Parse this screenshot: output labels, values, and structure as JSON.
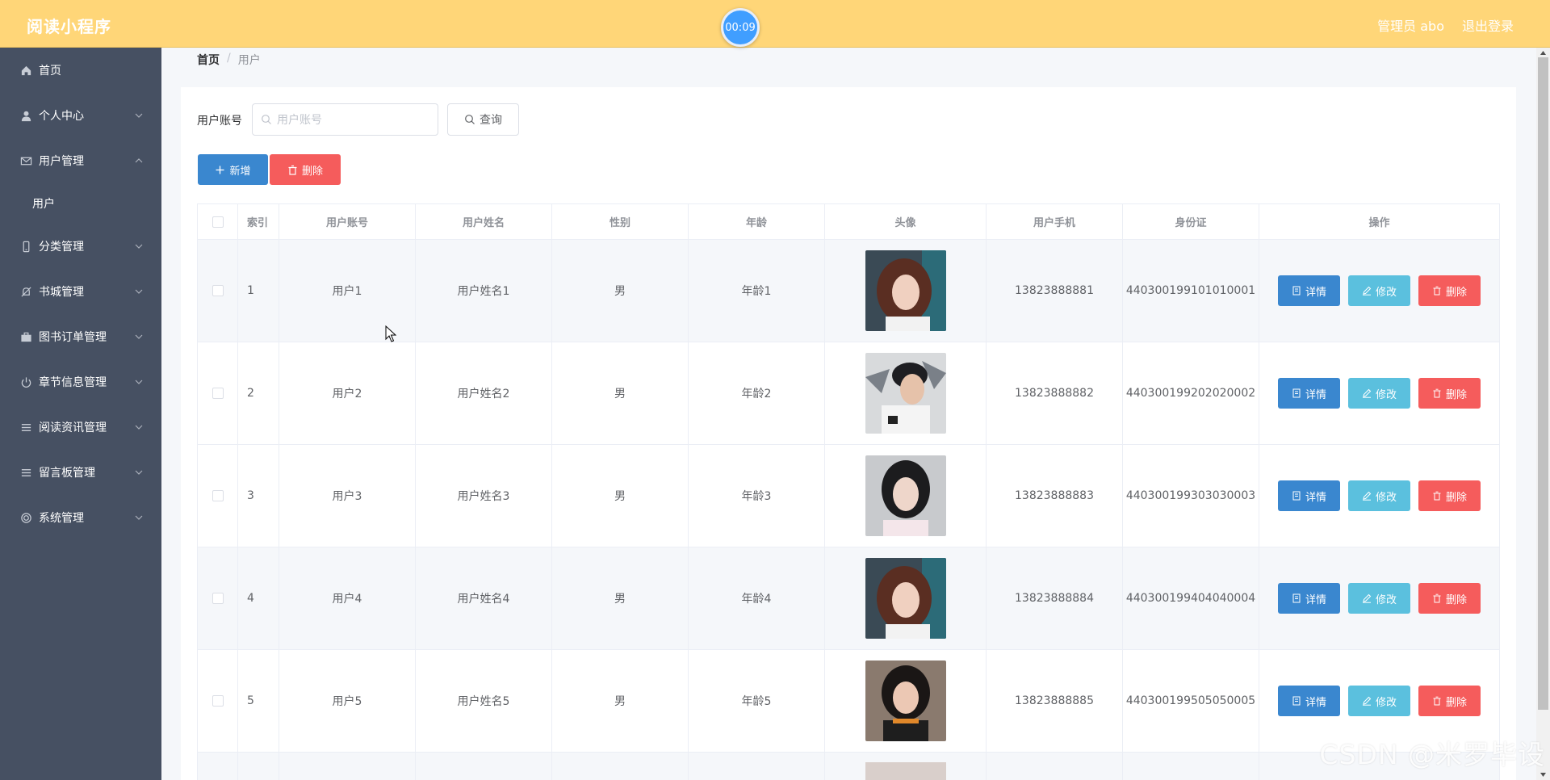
{
  "header": {
    "brand": "阅读小程序",
    "timer": "00:09",
    "admin": "管理员 abo",
    "logout": "退出登录"
  },
  "sidebar": {
    "items": [
      {
        "label": "首页",
        "icon": "home-icon"
      },
      {
        "label": "个人中心",
        "icon": "user-icon"
      },
      {
        "label": "用户管理",
        "icon": "mail-icon"
      },
      {
        "label": "用户",
        "sub": true
      },
      {
        "label": "分类管理",
        "icon": "phone-icon"
      },
      {
        "label": "书城管理",
        "icon": "bell-off-icon"
      },
      {
        "label": "图书订单管理",
        "icon": "briefcase-icon"
      },
      {
        "label": "章节信息管理",
        "icon": "power-icon"
      },
      {
        "label": "阅读资讯管理",
        "icon": "list-icon"
      },
      {
        "label": "留言板管理",
        "icon": "list-icon"
      },
      {
        "label": "系统管理",
        "icon": "target-icon"
      }
    ]
  },
  "breadcrumb": {
    "home": "首页",
    "sep": "/",
    "current": "用户"
  },
  "search": {
    "label": "用户账号",
    "placeholder": "用户账号",
    "button": "查询"
  },
  "actions": {
    "add": "新增",
    "delete": "删除"
  },
  "table": {
    "headers": [
      "索引",
      "用户账号",
      "用户姓名",
      "性别",
      "年龄",
      "头像",
      "用户手机",
      "身份证",
      "操作"
    ],
    "row_actions": {
      "detail": "详情",
      "edit": "修改",
      "delete": "删除"
    },
    "rows": [
      {
        "index": "1",
        "account": "用户1",
        "name": "用户姓名1",
        "gender": "男",
        "age": "年龄1",
        "phone": "13823888881",
        "id_card": "440300199101010001"
      },
      {
        "index": "2",
        "account": "用户2",
        "name": "用户姓名2",
        "gender": "男",
        "age": "年龄2",
        "phone": "13823888882",
        "id_card": "440300199202020002"
      },
      {
        "index": "3",
        "account": "用户3",
        "name": "用户姓名3",
        "gender": "男",
        "age": "年龄3",
        "phone": "13823888883",
        "id_card": "440300199303030003"
      },
      {
        "index": "4",
        "account": "用户4",
        "name": "用户姓名4",
        "gender": "男",
        "age": "年龄4",
        "phone": "13823888884",
        "id_card": "440300199404040004"
      },
      {
        "index": "5",
        "account": "用户5",
        "name": "用户姓名5",
        "gender": "男",
        "age": "年龄5",
        "phone": "13823888885",
        "id_card": "440300199505050005"
      }
    ]
  },
  "watermark": "CSDN @米罗毕设"
}
